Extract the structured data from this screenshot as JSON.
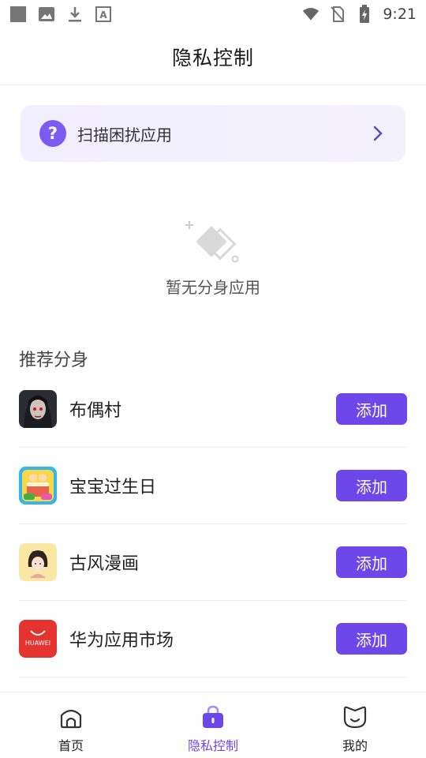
{
  "status_bar": {
    "time": "9:21",
    "left_icons": [
      "square-icon",
      "image-icon",
      "download-icon",
      "text-icon"
    ],
    "right_icons": [
      "wifi-icon",
      "no-sim-icon",
      "battery-charging-icon"
    ]
  },
  "header": {
    "title": "隐私控制"
  },
  "scan": {
    "label": "扫描困扰应用",
    "icon": "question-icon"
  },
  "empty": {
    "text": "暂无分身应用"
  },
  "recommend": {
    "title": "推荐分身",
    "apps": [
      {
        "name": "布偶村",
        "action": "添加",
        "icon": "dark-character-icon"
      },
      {
        "name": "宝宝过生日",
        "action": "添加",
        "icon": "birthday-cake-icon"
      },
      {
        "name": "古风漫画",
        "action": "添加",
        "icon": "ancient-girl-icon"
      },
      {
        "name": "华为应用市场",
        "action": "添加",
        "icon": "huawei-icon",
        "icon_text": "HUAWEI"
      }
    ]
  },
  "nav": {
    "items": [
      {
        "label": "首页",
        "icon": "home-icon",
        "active": false
      },
      {
        "label": "隐私控制",
        "icon": "lock-bag-icon",
        "active": true
      },
      {
        "label": "我的",
        "icon": "face-icon",
        "active": false
      }
    ]
  },
  "colors": {
    "accent": "#6d47ea",
    "banner_bg": "#f2efff"
  }
}
